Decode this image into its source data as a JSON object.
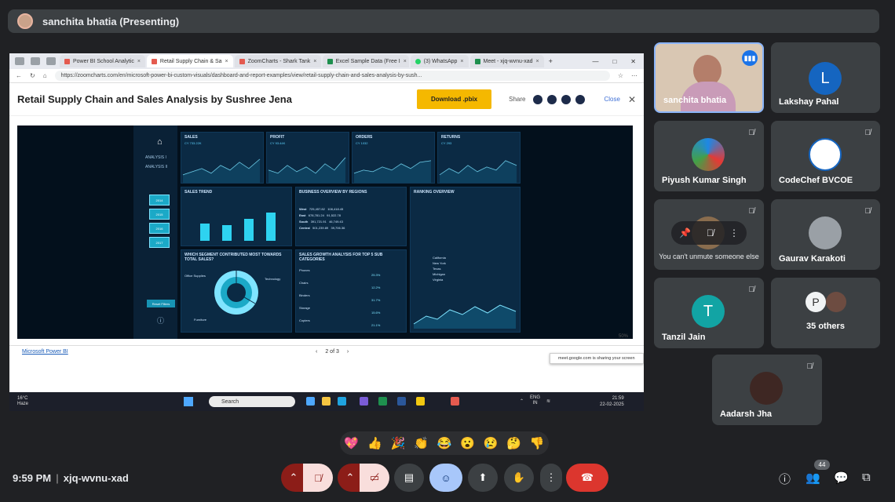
{
  "presenter": {
    "name": "sanchita bhatia (Presenting)"
  },
  "browser": {
    "tabs": [
      {
        "label": "Power BI School Analytic",
        "active": false
      },
      {
        "label": "Retail Supply Chain & Sa",
        "active": true
      },
      {
        "label": "ZoomCharts - Shark Tank",
        "active": false
      },
      {
        "label": "Excel Sample Data (Free I",
        "active": false
      },
      {
        "label": "(3) WhatsApp",
        "active": false
      },
      {
        "label": "Meet - xjq-wvnu-xad",
        "active": false
      }
    ],
    "url": "https://zoomcharts.com/en/microsoft-power-bi-custom-visuals/dashboard-and-report-examples/view/retail-supply-chain-and-sales-analysis-by-sush..."
  },
  "page": {
    "title": "Retail Supply Chain and Sales Analysis by Sushree Jena",
    "download_label": "Download .pbix",
    "share_label": "Share",
    "close_label": "Close",
    "pbi_link": "Microsoft Power BI",
    "pager": "2 of 3",
    "zoom": "50%",
    "sharing_notice": "meet.google.com is sharing your screen"
  },
  "report": {
    "nav": [
      "ANALYSIS I",
      "ANALYSIS II"
    ],
    "years": [
      "2014",
      "2015",
      "2016",
      "2017"
    ],
    "reset_label": "Reset Filters",
    "kpis": [
      {
        "title": "SALES",
        "value": "CY 733.22K"
      },
      {
        "title": "PROFIT",
        "value": "CY 93.44K"
      },
      {
        "title": "ORDERS",
        "value": "CY 1032"
      },
      {
        "title": "RETURNS",
        "value": "CY 293"
      }
    ],
    "sections": {
      "sales_trend": "SALES TREND",
      "business_overview": "BUSINESS OVERVIEW BY REGIONS",
      "ranking": "RANKING OVERVIEW",
      "segment": "WHICH SEGMENT CONTRIBUTED MOST TOWARDS TOTAL SALES?",
      "growth": "SALES GROWTH ANALYSIS FOR TOP 5 SUB CATEGORIES"
    },
    "regions": [
      {
        "region": "West",
        "sales": "725,457.82",
        "profit": "108,418.45"
      },
      {
        "region": "East",
        "sales": "678,781.24",
        "profit": "91,522.78"
      },
      {
        "region": "South",
        "sales": "391,721.91",
        "profit": "46,749.43"
      },
      {
        "region": "Central",
        "sales": "501,239.89",
        "profit": "39,706.36"
      }
    ],
    "subcats": [
      "Phones",
      "Chairs",
      "Binders",
      "Storage",
      "Copiers"
    ],
    "growth": [
      "25.3%",
      "12.2%",
      "31.7%",
      "15.6%",
      "21.1%"
    ],
    "states": [
      "California",
      "New York",
      "Texas",
      "Michigan",
      "Virginia"
    ],
    "segments": [
      "Office Supplies",
      "Technology",
      "Furniture"
    ]
  },
  "taskbar": {
    "weather_temp": "16°C",
    "weather_desc": "Haze",
    "search_placeholder": "Search",
    "lang": "ENG",
    "region": "IN",
    "time": "21:59",
    "date": "22-02-2025"
  },
  "participants": [
    {
      "name": "sanchita bhatia",
      "kind": "video"
    },
    {
      "name": "Lakshay Pahal",
      "initial": "L",
      "color": "#1565c0"
    },
    {
      "name": "Piyush Kumar Singh",
      "kind": "logo"
    },
    {
      "name": "CodeChef BVCOE",
      "kind": "logo"
    },
    {
      "name": "",
      "kind": "overlay"
    },
    {
      "name": "Gaurav Karakoti",
      "kind": "photo"
    },
    {
      "name": "Tanzil Jain",
      "initial": "T",
      "color": "#12a4a4"
    },
    {
      "name": "35 others",
      "initial": "P",
      "color": "#f1f3f4"
    },
    {
      "name": "Aadarsh Jha",
      "kind": "photo"
    }
  ],
  "unmute_tooltip": "You can't unmute someone else",
  "reactions": [
    "💖",
    "👍",
    "🎉",
    "👏",
    "😂",
    "😮",
    "😢",
    "🤔",
    "👎"
  ],
  "meeting": {
    "time": "9:59 PM",
    "code": "xjq-wvnu-xad",
    "participant_count": "44"
  },
  "colors": {
    "end_call": "#dc362e",
    "accent": "#a8c7fa",
    "dashboard_bg": "#03101c"
  }
}
